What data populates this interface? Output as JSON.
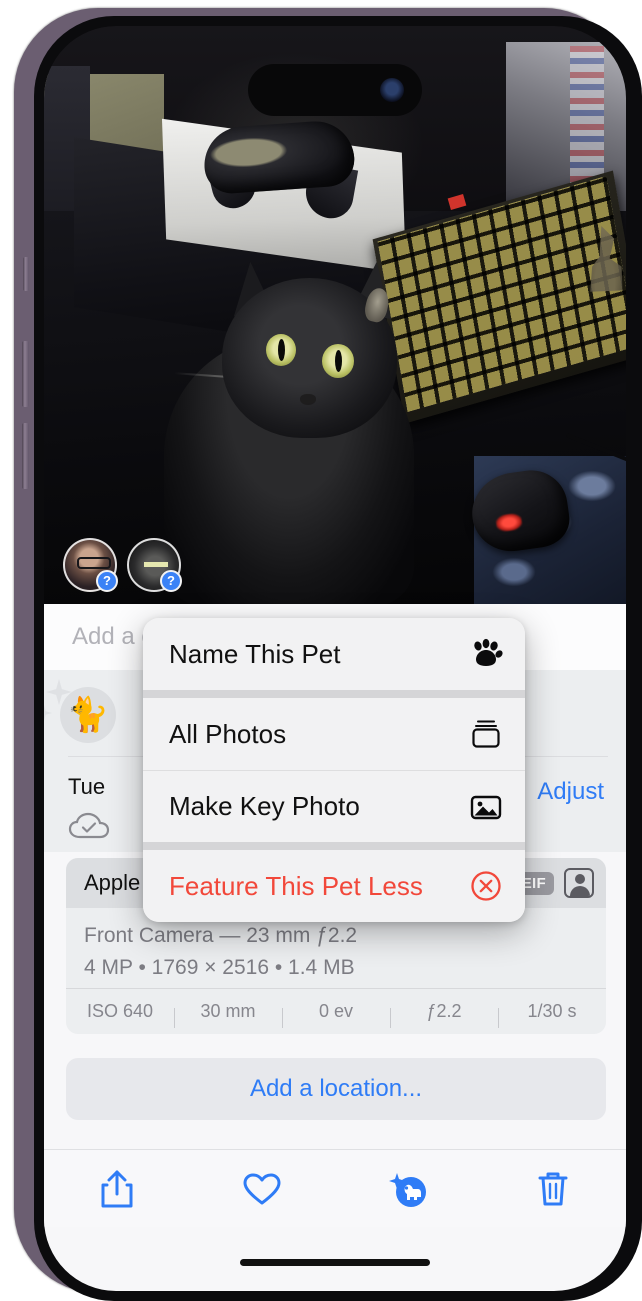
{
  "device": {
    "name": "iPhone 14 Pro",
    "frame_color": "#6b5e71"
  },
  "photo": {
    "alt_description": "Black cat on a desk with a game controller, backlit mechanical keyboard and gaming mouse",
    "faces": [
      {
        "name": "face-chip-person",
        "badge": "?",
        "kind": "person"
      },
      {
        "name": "face-chip-cat",
        "badge": "?",
        "kind": "pet"
      }
    ]
  },
  "caption": {
    "placeholder": "Add a caption..."
  },
  "pets_row": {
    "icon": "cat-silhouette-icon"
  },
  "date_row": {
    "date": "Tue",
    "sync_icon": "cloud-check-icon",
    "adjust_label": "Adjust"
  },
  "metadata": {
    "device": "Apple iPhone 13 mini",
    "format_badge": "HEIF",
    "portrait_icon": "portrait-mode-icon",
    "lens_line": "Front Camera — 23 mm ƒ2.2",
    "size_line": "4 MP • 1769 × 2516 • 1.4 MB",
    "exif": [
      {
        "label": "ISO 640"
      },
      {
        "label": "30 mm"
      },
      {
        "label": "0 ev"
      },
      {
        "label": "ƒ2.2"
      },
      {
        "label": "1/30 s"
      }
    ]
  },
  "location": {
    "label": "Add a location..."
  },
  "toolbar": {
    "items": [
      {
        "name": "share-button",
        "icon": "share-icon"
      },
      {
        "name": "favorite-button",
        "icon": "heart-icon"
      },
      {
        "name": "pet-info-button",
        "icon": "pet-sparkle-icon"
      },
      {
        "name": "delete-button",
        "icon": "trash-icon"
      }
    ]
  },
  "context_menu": {
    "groups": [
      {
        "items": [
          {
            "label": "Name This Pet",
            "icon": "paw-icon",
            "destructive": false
          }
        ]
      },
      {
        "items": [
          {
            "label": "All Photos",
            "icon": "stack-icon",
            "destructive": false
          },
          {
            "label": "Make Key Photo",
            "icon": "photo-icon",
            "destructive": false
          }
        ]
      },
      {
        "items": [
          {
            "label": "Feature This Pet Less",
            "icon": "circle-x-icon",
            "destructive": true
          }
        ]
      }
    ]
  },
  "colors": {
    "accent_blue": "#2f7cf6",
    "destructive_red": "#f2483a",
    "sheet_bg": "#f7f7f9"
  }
}
